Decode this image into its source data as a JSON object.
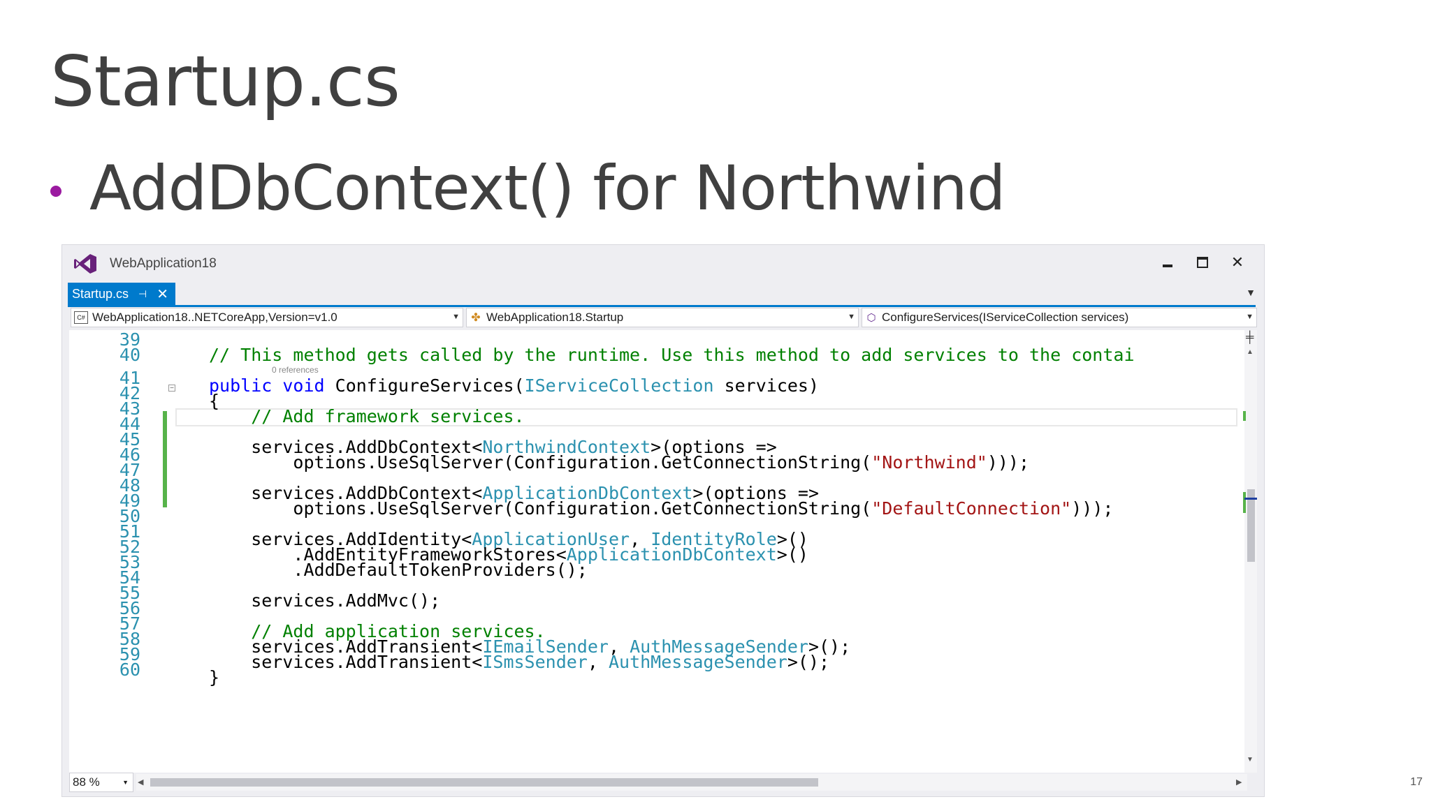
{
  "slide": {
    "title": "Startup.cs",
    "bullet": "AddDbContext() for Northwind",
    "page_number": "17",
    "accent_color": "#9b1aa0"
  },
  "window": {
    "app_title": "WebApplication18",
    "minimize_icon": "minimize-icon",
    "maximize_icon": "maximize-icon",
    "close_icon": "close-icon"
  },
  "tab": {
    "label": "Startup.cs",
    "pin_icon": "pin-icon",
    "close_icon": "close-icon"
  },
  "navbar": {
    "project": "WebApplication18..NETCoreApp,Version=v1.0",
    "type": "WebApplication18.Startup",
    "member": "ConfigureServices(IServiceCollection services)"
  },
  "editor": {
    "line_numbers": [
      "39",
      "40",
      "41",
      "42",
      "43",
      "44",
      "45",
      "46",
      "47",
      "48",
      "49",
      "50",
      "51",
      "52",
      "53",
      "54",
      "55",
      "56",
      "57",
      "58",
      "59",
      "60"
    ],
    "references_lens": "0 references",
    "colors": {
      "keyword": "#0000ff",
      "type": "#2b91af",
      "comment": "#008000",
      "string": "#a31515"
    }
  },
  "zoom": "88 %"
}
